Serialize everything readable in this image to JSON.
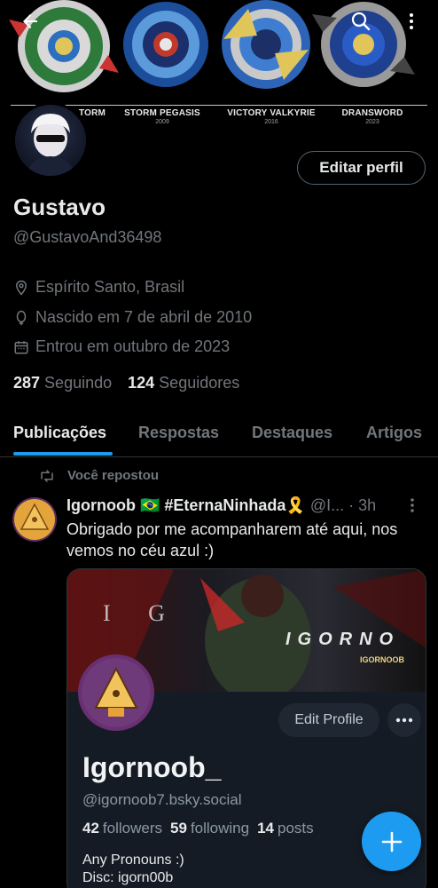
{
  "banner": {
    "beys": [
      {
        "label": "TORM",
        "year": ""
      },
      {
        "label": "STORM PEGASIS",
        "year": "2009"
      },
      {
        "label": "VICTORY VALKYRIE",
        "year": "2016"
      },
      {
        "label": "DRANSWORD",
        "year": "2023"
      }
    ]
  },
  "header": {
    "back_icon": "arrow-left-icon",
    "search_icon": "search-icon",
    "more_icon": "more-vertical-icon"
  },
  "profile": {
    "edit_label": "Editar perfil",
    "name": "Gustavo",
    "handle": "@GustavoAnd36498",
    "location": "Espírito Santo, Brasil",
    "birth": "Nascido em 7 de abril de 2010",
    "joined": "Entrou em outubro de 2023",
    "following_count": "287",
    "following_label": "Seguindo",
    "followers_count": "124",
    "followers_label": "Seguidores"
  },
  "tabs": [
    "Publicações",
    "Respostas",
    "Destaques",
    "Artigos"
  ],
  "post": {
    "repost_label": "Você repostou",
    "author": "Igornoob 🇧🇷 #EternaNinhada🎗️",
    "author_handle": "@I...",
    "time": "· 3h",
    "text": "Obrigado por me acompanharem até aqui, nos vemos no céu azul :)"
  },
  "card": {
    "banner_text": "IGORNO",
    "banner_sub": "IGORNOOB",
    "edit_label": "Edit Profile",
    "name": "Igornoob_",
    "handle": "@igornoob7.bsky.social",
    "followers_count": "42",
    "followers_label": "followers",
    "following_count": "59",
    "following_label": "following",
    "posts_count": "14",
    "posts_label": "posts",
    "bio_line1": "Any Pronouns :)",
    "bio_line2": "Disc: igorn00b"
  },
  "colors": {
    "accent": "#1d9bf0",
    "background": "#000000",
    "muted": "#71767b"
  }
}
